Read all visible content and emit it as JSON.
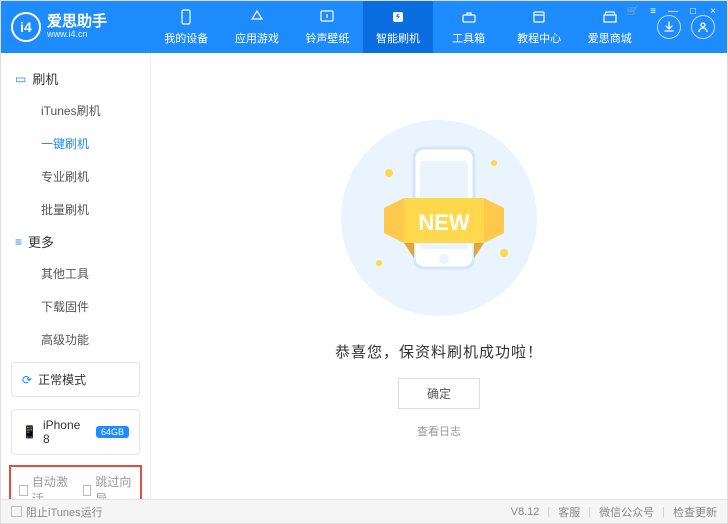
{
  "app": {
    "logo_text": "爱思助手",
    "logo_sub": "www.i4.cn",
    "logo_badge": "i4"
  },
  "nav": [
    {
      "label": "我的设备",
      "icon": "phone"
    },
    {
      "label": "应用游戏",
      "icon": "apps"
    },
    {
      "label": "铃声壁纸",
      "icon": "music"
    },
    {
      "label": "智能刷机",
      "icon": "flash",
      "active": true
    },
    {
      "label": "工具箱",
      "icon": "toolbox"
    },
    {
      "label": "教程中心",
      "icon": "book"
    },
    {
      "label": "爱思商城",
      "icon": "store"
    }
  ],
  "header_right": {
    "download": "download",
    "user": "user"
  },
  "sidebar": {
    "sections": [
      {
        "title": "刷机",
        "items": [
          {
            "label": "iTunes刷机"
          },
          {
            "label": "一键刷机",
            "active": true
          },
          {
            "label": "专业刷机"
          },
          {
            "label": "批量刷机"
          }
        ]
      },
      {
        "title": "更多",
        "items": [
          {
            "label": "其他工具"
          },
          {
            "label": "下载固件"
          },
          {
            "label": "高级功能"
          }
        ]
      }
    ],
    "mode_box": {
      "label": "正常模式"
    },
    "device_box": {
      "name": "iPhone 8",
      "storage": "64GB"
    },
    "auto_activate": "自动激活",
    "skip_guide": "跳过向导"
  },
  "main": {
    "banner": "NEW",
    "message": "恭喜您，保资料刷机成功啦！",
    "ok": "确定",
    "view_log": "查看日志"
  },
  "footer": {
    "block_itunes": "阻止iTunes运行",
    "version": "V8.12",
    "support": "客服",
    "wechat": "微信公众号",
    "check_update": "检查更新"
  }
}
